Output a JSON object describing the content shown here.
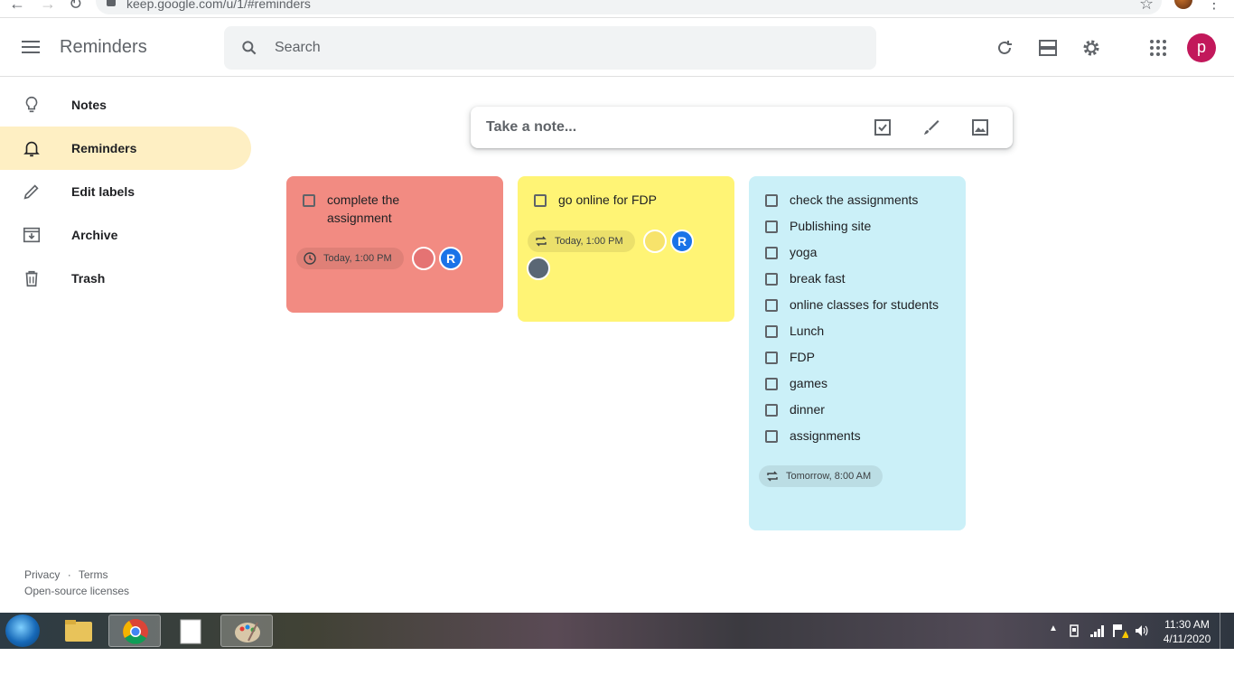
{
  "browser": {
    "url": "keep.google.com/u/1/#reminders"
  },
  "header": {
    "title": "Reminders",
    "search_placeholder": "Search",
    "profile_initial": "p"
  },
  "sidebar": {
    "items": [
      {
        "label": "Notes",
        "icon": "lightbulb-icon"
      },
      {
        "label": "Reminders",
        "icon": "bell-icon",
        "active": true
      },
      {
        "label": "Edit labels",
        "icon": "pencil-icon"
      },
      {
        "label": "Archive",
        "icon": "archive-icon"
      },
      {
        "label": "Trash",
        "icon": "trash-icon"
      }
    ]
  },
  "footer": {
    "privacy": "Privacy",
    "separator": "·",
    "terms": "Terms",
    "licenses": "Open-source licenses"
  },
  "take_note": {
    "placeholder": "Take a note..."
  },
  "notes": [
    {
      "color": "#f28b82",
      "items": [
        "complete the assignment"
      ],
      "reminder": "Today, 1:00 PM",
      "reminder_icon": "clock-icon"
    },
    {
      "color": "#fff475",
      "items": [
        "go online for FDP"
      ],
      "reminder": "Today, 1:00 PM",
      "reminder_icon": "repeat-icon"
    },
    {
      "color": "#cbf0f8",
      "items": [
        "check the assignments",
        "Publishing site",
        "yoga",
        "break fast",
        "online classes for students",
        "Lunch",
        "FDP",
        "games",
        "dinner",
        "assignments"
      ],
      "reminder": "Tomorrow, 8:00 AM",
      "reminder_icon": "repeat-icon"
    }
  ],
  "collaborator_initial": "R",
  "taskbar": {
    "time": "11:30 AM",
    "date": "4/11/2020"
  }
}
